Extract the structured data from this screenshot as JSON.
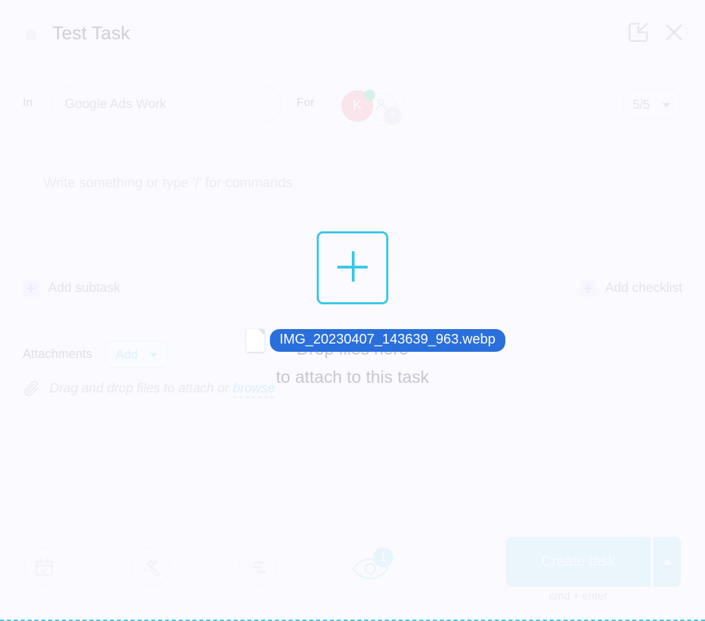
{
  "header": {
    "title": "Test Task",
    "checkbox_name": "task-complete-checkbox",
    "collapse_icon": "collapse-to-corner-icon",
    "close_icon": "close-icon"
  },
  "meta": {
    "in_label": "In",
    "project_value": "Google Ads Work",
    "for_label": "For",
    "assignee_initial": "K",
    "add_assignee_badge": "+",
    "points_value": "5/5"
  },
  "editor": {
    "placeholder": "Write something or type '/' for commands"
  },
  "subtask_row": {
    "add_subtask_label": "Add subtask",
    "add_checklist_label": "Add checklist"
  },
  "attachments": {
    "label": "Attachments",
    "add_button_label": "Add",
    "hint_prefix": "Drag and drop files to attach or ",
    "browse_label": "browse"
  },
  "drop_overlay": {
    "line1": "Drop files here",
    "line2": "to attach to this task",
    "plus_glyph": "+"
  },
  "drag_ghost": {
    "filename": "IMG_20230407_143639_963.webp"
  },
  "footer": {
    "tools": [
      {
        "name": "due-date-icon",
        "label": "Due date"
      },
      {
        "name": "magic-wand-icon",
        "label": "AI assist"
      },
      {
        "name": "priority-icon",
        "label": "Priority"
      },
      {
        "name": "watch-eye-icon",
        "label": "Watchers"
      }
    ],
    "watch_count": "1",
    "create_label": "Create task",
    "create_shortcut": "cmd + enter"
  },
  "colors": {
    "accent_cyan": "#35c8e8",
    "accent_cyan_soft": "#c6ecf5",
    "background": "#fafaff",
    "avatar_pink": "#f9b6bc",
    "online_green": "#7de0b5",
    "drag_pill_blue": "#2a6fdb"
  }
}
